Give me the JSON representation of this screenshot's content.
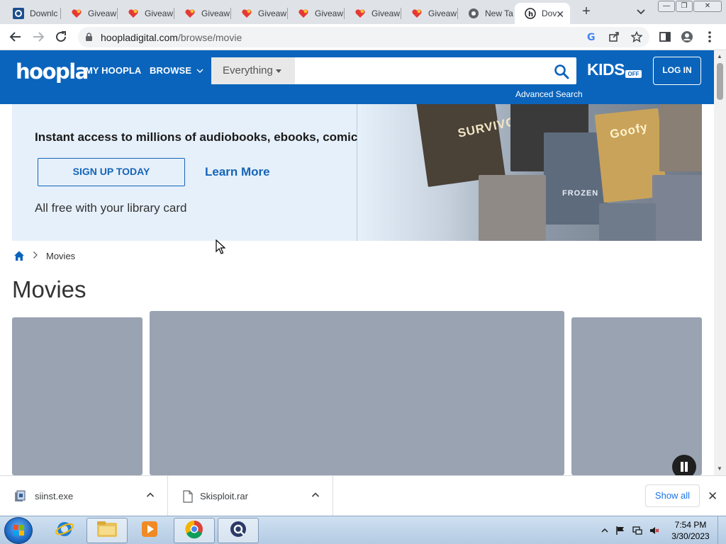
{
  "tabs": [
    {
      "title": "Downlc",
      "icon": "qr-icon"
    },
    {
      "title": "Giveaw",
      "icon": "heart-icon"
    },
    {
      "title": "Giveaw",
      "icon": "heart-icon"
    },
    {
      "title": "Giveaw",
      "icon": "heart-icon"
    },
    {
      "title": "Giveaw",
      "icon": "heart-icon"
    },
    {
      "title": "Giveaw",
      "icon": "heart-icon"
    },
    {
      "title": "Giveaw",
      "icon": "heart-icon"
    },
    {
      "title": "Giveaw",
      "icon": "heart-icon"
    },
    {
      "title": "New Ta",
      "icon": "chrome-icon"
    },
    {
      "title": "Dov",
      "icon": "hoopla-h-icon"
    }
  ],
  "window_controls": {
    "minimize": "—",
    "restore": "❐",
    "close": "✕"
  },
  "address": {
    "domain": "hoopladigital.com",
    "path": "/browse/movie"
  },
  "header": {
    "logo": "hoopla",
    "nav": {
      "my_hoopla": "MY HOOPLA",
      "browse": "BROWSE"
    },
    "search": {
      "category": "Everything",
      "placeholder": ""
    },
    "kids": "KIDS",
    "kids_badge": "OFF",
    "login": "LOG IN",
    "advanced_search": "Advanced Search"
  },
  "promo": {
    "headline": "Instant access to millions of audiobooks, ebooks, comics, and more",
    "signup": "SIGN UP TODAY",
    "learn_more": "Learn More",
    "free_text": "All free with your library card",
    "covers": {
      "survivor": "SURVIVOR",
      "goofy": "Goofy",
      "frozen": "FROZEN"
    }
  },
  "breadcrumb": {
    "current": "Movies"
  },
  "page_title": "Movies",
  "downloads": {
    "items": [
      {
        "name": "siinst.exe"
      },
      {
        "name": "Skisploit.rar"
      }
    ],
    "show_all": "Show all"
  },
  "taskbar": {
    "time": "7:54 PM",
    "date": "3/30/2023"
  },
  "colors": {
    "brand": "#0a64bc",
    "link": "#1565b8",
    "promo_bg": "#e6f0fa",
    "placeholder_card": "#9aa3b2"
  }
}
